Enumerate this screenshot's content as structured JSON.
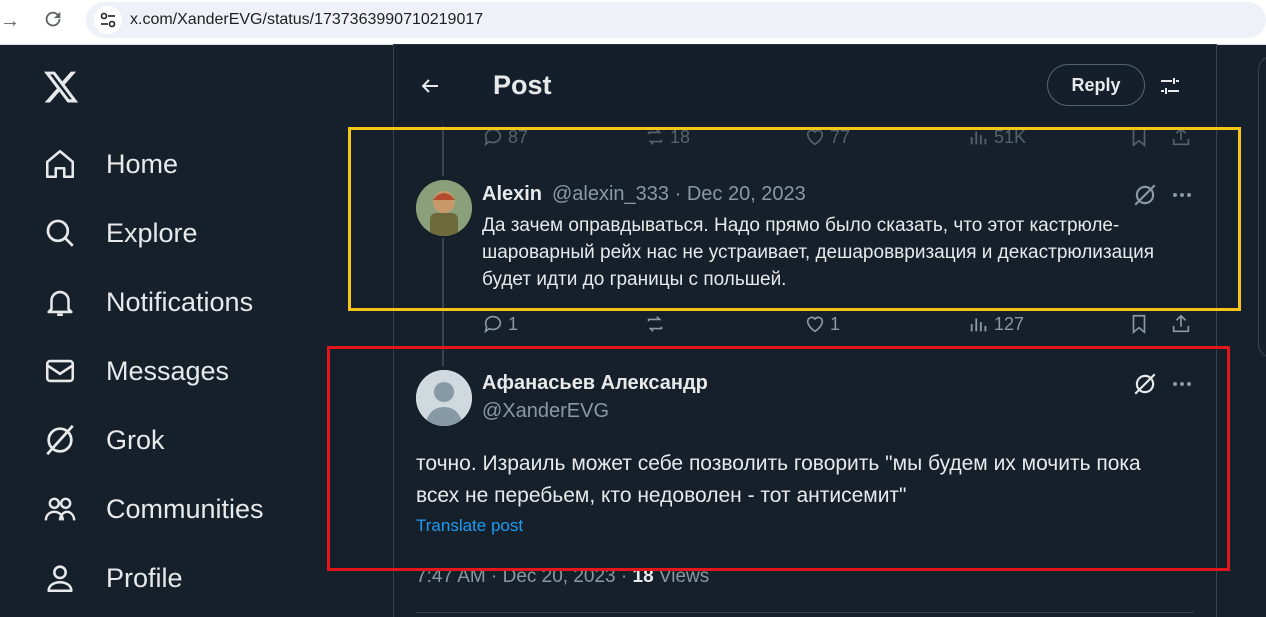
{
  "browser": {
    "url": "x.com/XanderEVG/status/1737363990710219017"
  },
  "nav": {
    "items": [
      {
        "label": "Home",
        "icon": "home-icon"
      },
      {
        "label": "Explore",
        "icon": "search-icon"
      },
      {
        "label": "Notifications",
        "icon": "bell-icon"
      },
      {
        "label": "Messages",
        "icon": "envelope-icon"
      },
      {
        "label": "Grok",
        "icon": "grok-icon"
      },
      {
        "label": "Communities",
        "icon": "people-icon"
      },
      {
        "label": "Profile",
        "icon": "person-icon"
      }
    ]
  },
  "header": {
    "title": "Post",
    "reply_label": "Reply"
  },
  "prev_actions": {
    "replies": "87",
    "reposts": "18",
    "likes": "77",
    "views": "51K"
  },
  "tweet1": {
    "name": "Alexin",
    "handle_date": "@alexin_333 · Dec 20, 2023",
    "text": "Да зачем оправдываться. Надо прямо было сказать, что этот кастрюле-шароварный рейх нас не устраивает, дешароввризация и декастрюлизация будет идти до границы с польшей.",
    "replies": "1",
    "likes": "1",
    "views": "127"
  },
  "tweet2": {
    "name": "Афанасьев Александр",
    "handle": "@XanderEVG",
    "text": "точно. Израиль может себе позволить говорить \"мы будем их мочить пока всех не перебьем, кто недоволен - тот антисемит\"",
    "translate": "Translate post",
    "time": "7:47 AM · Dec 20, 2023 · ",
    "views_count": "18",
    "views_label": " Views"
  },
  "colors": {
    "background": "#15202b",
    "accent": "#1d9bf0",
    "annotation_yellow": "#f5c518",
    "annotation_red": "#e3161b"
  }
}
